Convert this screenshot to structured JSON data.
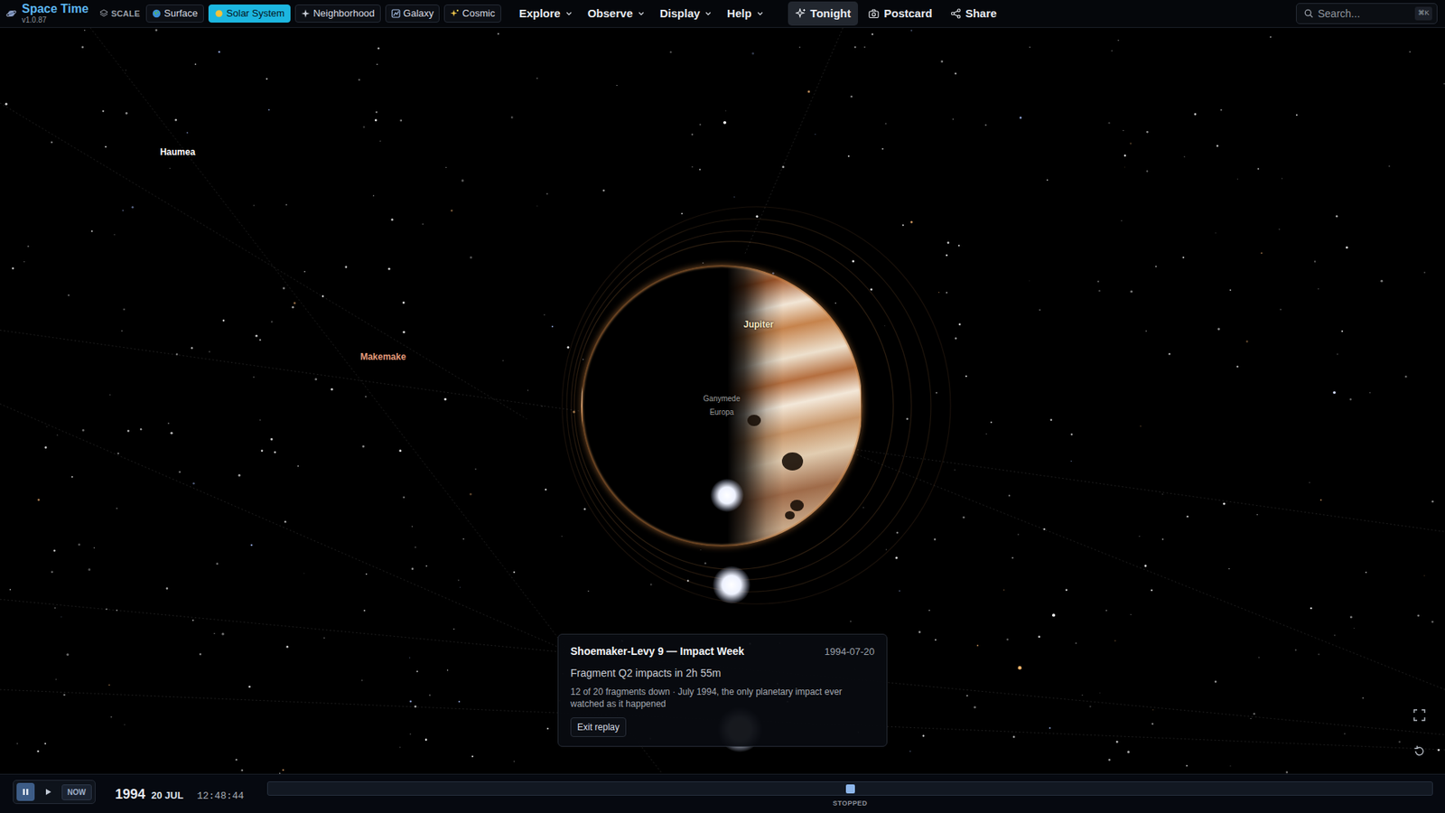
{
  "app": {
    "title": "Space Time",
    "version": "v1.0.87"
  },
  "scale": {
    "label": "SCALE",
    "options": [
      {
        "label": "Surface",
        "selected": false
      },
      {
        "label": "Solar System",
        "selected": true
      },
      {
        "label": "Neighborhood",
        "selected": false
      },
      {
        "label": "Galaxy",
        "selected": false
      },
      {
        "label": "Cosmic",
        "selected": false
      }
    ]
  },
  "menus": [
    {
      "label": "Explore"
    },
    {
      "label": "Observe"
    },
    {
      "label": "Display"
    },
    {
      "label": "Help"
    }
  ],
  "actions": [
    {
      "label": "Tonight",
      "selected": true
    },
    {
      "label": "Postcard",
      "selected": false
    },
    {
      "label": "Share",
      "selected": false
    }
  ],
  "search": {
    "placeholder": "Search...",
    "shortcut": "⌘K"
  },
  "labels": [
    {
      "name": "Haumea",
      "color": "#ffffff"
    },
    {
      "name": "Makemake",
      "color": "#e39a7a"
    },
    {
      "name": "Jupiter",
      "color": "#f4e6c0"
    },
    {
      "name": "Ganymede",
      "color": "#9a9a9a"
    },
    {
      "name": "Europa",
      "color": "#9a9a9a"
    }
  ],
  "event": {
    "title": "Shoemaker-Levy 9 — Impact Week",
    "date": "1994-07-20",
    "headline": "Fragment Q2 impacts in 2h 55m",
    "detail": "12 of 20 fragments down · July 1994, the only planetary impact ever watched as it happened",
    "button": "Exit replay"
  },
  "timebar": {
    "pause": {
      "selected": true
    },
    "play": {
      "selected": false
    },
    "now": {
      "label": "NOW"
    },
    "year": "1994",
    "date": "20 JUL",
    "time": "12:48:44",
    "level": 0.5,
    "status": "STOPPED"
  }
}
